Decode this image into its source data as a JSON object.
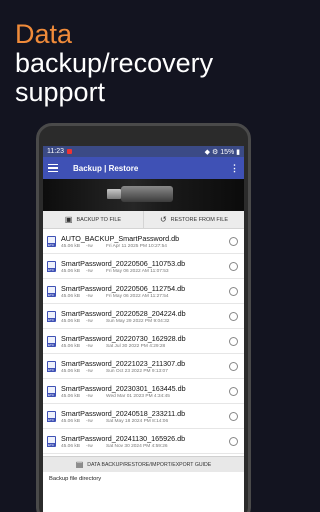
{
  "promo": {
    "line1": "Data",
    "line2": "backup/recovery",
    "line3": "support"
  },
  "statusbar": {
    "time": "11:23",
    "right": "◆ ⚙ 15% ▮"
  },
  "toolbar": {
    "title": "Backup | Restore"
  },
  "actions": {
    "backup_label": "BACKUP TO FILE",
    "restore_label": "RESTORE FROM FILE"
  },
  "files": [
    {
      "name": "AUTO_BACKUP_SmartPassword.db",
      "size": "45.06 kB",
      "perm": "-rw",
      "date": "Fri Apr 11 2025 PM 10:27:54"
    },
    {
      "name": "SmartPassword_20220506_110753.db",
      "size": "45.06 kB",
      "perm": "-rw",
      "date": "Fri May 06 2022 AM 11:07:53"
    },
    {
      "name": "SmartPassword_20220506_112754.db",
      "size": "45.06 kB",
      "perm": "-rw",
      "date": "Fri May 06 2022 AM 11:27:54"
    },
    {
      "name": "SmartPassword_20220528_204224.db",
      "size": "45.06 kB",
      "perm": "-rw",
      "date": "Sun May 29 2022 PM 9:04:32"
    },
    {
      "name": "SmartPassword_20220730_162928.db",
      "size": "45.06 kB",
      "perm": "-rw",
      "date": "Sat Jul 30 2022 PM 4:29:28"
    },
    {
      "name": "SmartPassword_20221023_211307.db",
      "size": "45.06 kB",
      "perm": "-rw",
      "date": "Sun Oct 23 2022 PM 9:13:07"
    },
    {
      "name": "SmartPassword_20230301_163445.db",
      "size": "45.06 kB",
      "perm": "-rw",
      "date": "Wed Mar 01 2023 PM 4:34:45"
    },
    {
      "name": "SmartPassword_20240518_233211.db",
      "size": "45.06 kB",
      "perm": "-rw",
      "date": "Sat May 18 2024 PM 8:14:06"
    },
    {
      "name": "SmartPassword_20241130_165926.db",
      "size": "45.06 kB",
      "perm": "-rw",
      "date": "Sat Nov 30 2024 PM 4:59:26"
    }
  ],
  "guide": {
    "label": "DATA BACKUP/RESTORE/IMPORT/EXPORT GUIDE"
  },
  "directory": {
    "label": "Backup file directory"
  },
  "colors": {
    "accent": "#f08b3a",
    "appbar": "#3f51b5",
    "background": "#131420"
  }
}
